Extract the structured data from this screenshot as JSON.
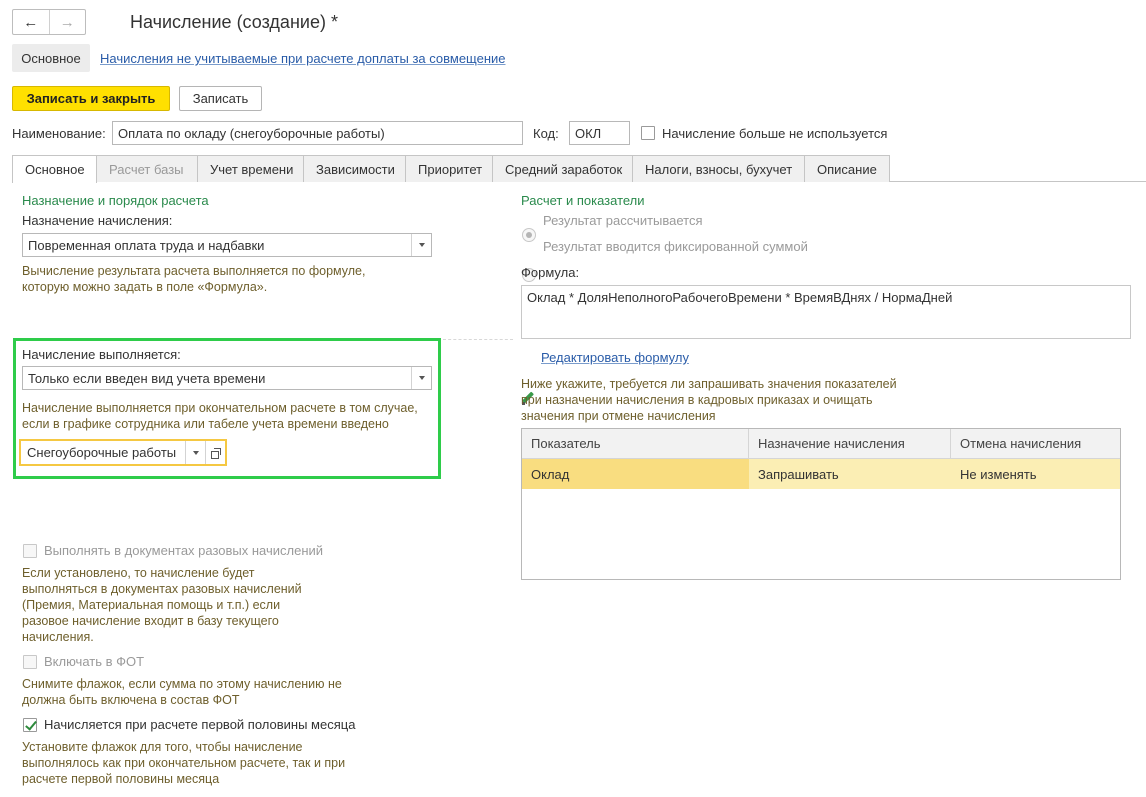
{
  "window": {
    "title": "Начисление (создание) *",
    "back_icon": "arrow-left-icon",
    "forward_icon": "arrow-right-icon"
  },
  "sections": {
    "main": "Основное",
    "link": "Начисления не учитываемые при расчете доплаты за совмещение"
  },
  "toolbar": {
    "save_close": "Записать и закрыть",
    "save": "Записать"
  },
  "header": {
    "name_label": "Наименование:",
    "name_value": "Оплата по окладу (снегоуборочные работы)",
    "code_label": "Код:",
    "code_value": "ОКЛ",
    "unused_label": "Начисление больше не используется"
  },
  "tabs": [
    {
      "label": "Основное"
    },
    {
      "label": "Расчет базы"
    },
    {
      "label": "Учет времени"
    },
    {
      "label": "Зависимости"
    },
    {
      "label": "Приоритет"
    },
    {
      "label": "Средний заработок"
    },
    {
      "label": "Налоги, взносы, бухучет"
    },
    {
      "label": "Описание"
    }
  ],
  "left": {
    "group_title": "Назначение и порядок расчета",
    "purpose_label": "Назначение начисления:",
    "purpose_value": "Повременная оплата труда и надбавки",
    "purpose_note_1": "Вычисление результата расчета выполняется по формуле,",
    "purpose_note_2": "которую можно задать в поле «Формула».",
    "exec_label": "Начисление выполняется:",
    "exec_value": "Только если введен вид учета времени",
    "exec_note_1": "Начисление выполняется при окончательном расчете в том случае,",
    "exec_note_2": "если в графике сотрудника или табеле учета времени введено",
    "time_type_value": "Снегоуборочные работы",
    "one_time_label": "Выполнять в документах разовых начислений",
    "one_time_note": [
      "Если установлено, то начисление будет",
      "выполняться в документах разовых начислений",
      "(Премия, Материальная помощь и т.п.) если",
      "разовое начисление входит в базу текущего",
      "начисления."
    ],
    "fot_label": "Включать в ФОТ",
    "fot_note": [
      "Снимите флажок, если сумма по этому начислению не",
      "должна быть включена в состав ФОТ"
    ],
    "first_half_label": "Начисляется при расчете первой половины месяца",
    "first_half_note": [
      "Установите флажок для того, чтобы начисление",
      "выполнялось как при окончательном расчете, так и при",
      "расчете первой половины месяца"
    ]
  },
  "right": {
    "group_title": "Расчет и показатели",
    "radio_calc": "Результат рассчитывается",
    "radio_fixed": "Результат вводится фиксированной суммой",
    "formula_label": "Формула:",
    "formula_value": "Оклад * ДоляНеполногоРабочегоВремени * ВремяВДнях / НормаДней",
    "edit_formula": "Редактировать формулу",
    "hint": [
      "Ниже укажите, требуется ли запрашивать значения показателей",
      "при назначении начисления в кадровых приказах и очищать",
      "значения при отмене начисления"
    ],
    "table": {
      "headers": [
        "Показатель",
        "Назначение начисления",
        "Отмена начисления"
      ],
      "rows": [
        [
          "Оклад",
          "Запрашивать",
          "Не изменять"
        ]
      ]
    }
  },
  "colors": {
    "accent_yellow": "#ffe000",
    "group_green": "#2a8a4c",
    "highlight_green": "#2ecc4a",
    "highlight_yellow": "#f5c842",
    "link_blue": "#2a5ca8"
  }
}
